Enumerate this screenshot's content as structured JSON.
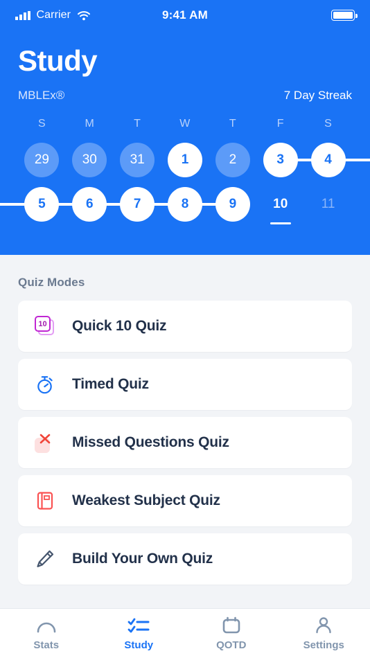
{
  "status_bar": {
    "signal_icon": "signal-bars-icon",
    "carrier": "Carrier",
    "wifi_icon": "wifi-icon",
    "time": "9:41 AM",
    "battery_icon": "battery-icon"
  },
  "header": {
    "title": "Study",
    "subtitle": "MBLEx®",
    "streak": "7 Day Streak",
    "background_color": "#1a73f5"
  },
  "calendar": {
    "day_headers": [
      "S",
      "M",
      "T",
      "W",
      "T",
      "F",
      "S"
    ],
    "weeks": [
      [
        {
          "label": "29",
          "state": "muted"
        },
        {
          "label": "30",
          "state": "muted"
        },
        {
          "label": "31",
          "state": "muted"
        },
        {
          "label": "1",
          "state": "filled"
        },
        {
          "label": "2",
          "state": "muted"
        },
        {
          "label": "3",
          "state": "filled"
        },
        {
          "label": "4",
          "state": "filled"
        }
      ],
      [
        {
          "label": "5",
          "state": "filled"
        },
        {
          "label": "6",
          "state": "filled"
        },
        {
          "label": "7",
          "state": "filled"
        },
        {
          "label": "8",
          "state": "filled"
        },
        {
          "label": "9",
          "state": "filled"
        },
        {
          "label": "10",
          "state": "today"
        },
        {
          "label": "11",
          "state": "future"
        }
      ]
    ]
  },
  "quiz_modes": {
    "section_label": "Quiz Modes",
    "items": [
      {
        "label": "Quick 10 Quiz",
        "icon": "stacked-cards-10-icon",
        "badge": "10",
        "color": "#c026d3"
      },
      {
        "label": "Timed Quiz",
        "icon": "stopwatch-icon",
        "color": "#1a73f5"
      },
      {
        "label": "Missed Questions Quiz",
        "icon": "red-x-icon",
        "color": "#f04438"
      },
      {
        "label": "Weakest Subject Quiz",
        "icon": "book-icon",
        "color": "#fa5252"
      },
      {
        "label": "Build Your Own Quiz",
        "icon": "pencil-icon",
        "color": "#46566e"
      }
    ]
  },
  "tab_bar": {
    "active": "Study",
    "tabs": [
      {
        "label": "Stats",
        "icon": "gauge-arc-icon"
      },
      {
        "label": "Study",
        "icon": "checklist-icon"
      },
      {
        "label": "QOTD",
        "icon": "calendar-icon"
      },
      {
        "label": "Settings",
        "icon": "person-icon"
      }
    ]
  }
}
